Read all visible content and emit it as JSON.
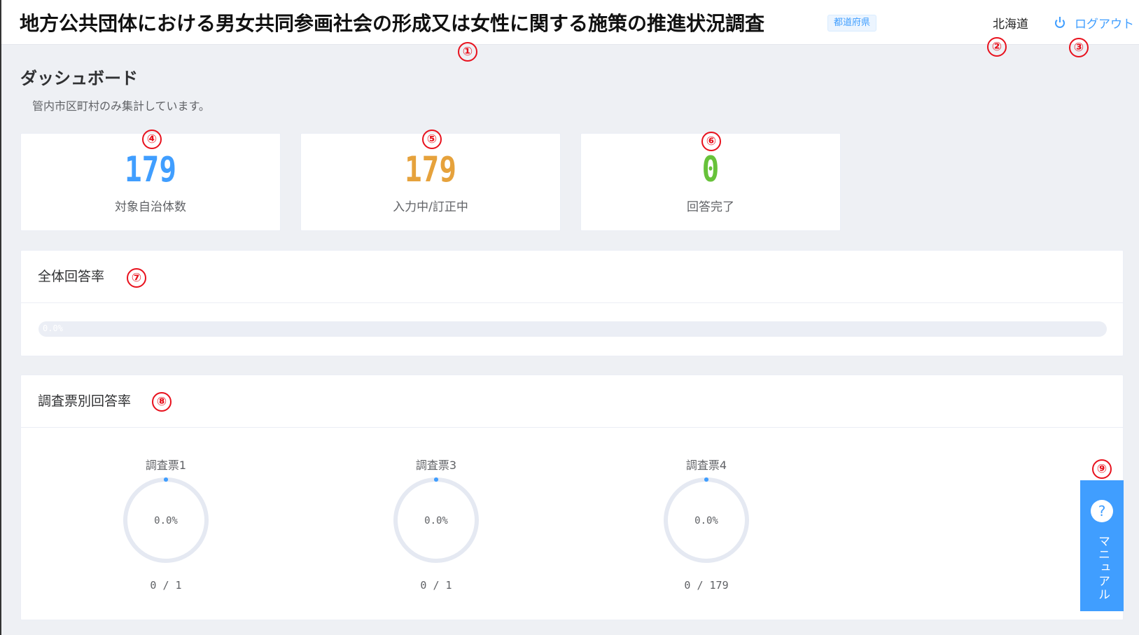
{
  "header": {
    "title": "地方公共団体における男女共同参画社会の形成又は女性に関する施策の推進状況調査",
    "pref_tag": "都道府県",
    "user": "北海道",
    "logout_label": "ログアウト"
  },
  "page": {
    "heading": "ダッシュボード",
    "note": "管内市区町村のみ集計しています。"
  },
  "stats": [
    {
      "value": "179",
      "label": "対象自治体数",
      "color": "#409eff"
    },
    {
      "value": "179",
      "label": "入力中/訂正中",
      "color": "#e6a23c"
    },
    {
      "value": "0",
      "label": "回答完了",
      "color": "#67c23a"
    }
  ],
  "overall": {
    "title": "全体回答率",
    "percent": 0.0,
    "text": "0.0%"
  },
  "by_survey": {
    "title": "調査票別回答率",
    "items": [
      {
        "name": "調査票1",
        "percent": 0.0,
        "text": "0.0%",
        "count": "0 / 1"
      },
      {
        "name": "調査票3",
        "percent": 0.0,
        "text": "0.0%",
        "count": "0 / 1"
      },
      {
        "name": "調査票4",
        "percent": 0.0,
        "text": "0.0%",
        "count": "0 / 179"
      }
    ]
  },
  "manual": {
    "label": "マニュアル",
    "icon": "help-icon"
  },
  "markers": [
    "①",
    "②",
    "③",
    "④",
    "⑤",
    "⑥",
    "⑦",
    "⑧",
    "⑨"
  ],
  "colors": {
    "accent": "#409eff",
    "warning": "#e6a23c",
    "success": "#67c23a",
    "marker": "#e8111d"
  }
}
